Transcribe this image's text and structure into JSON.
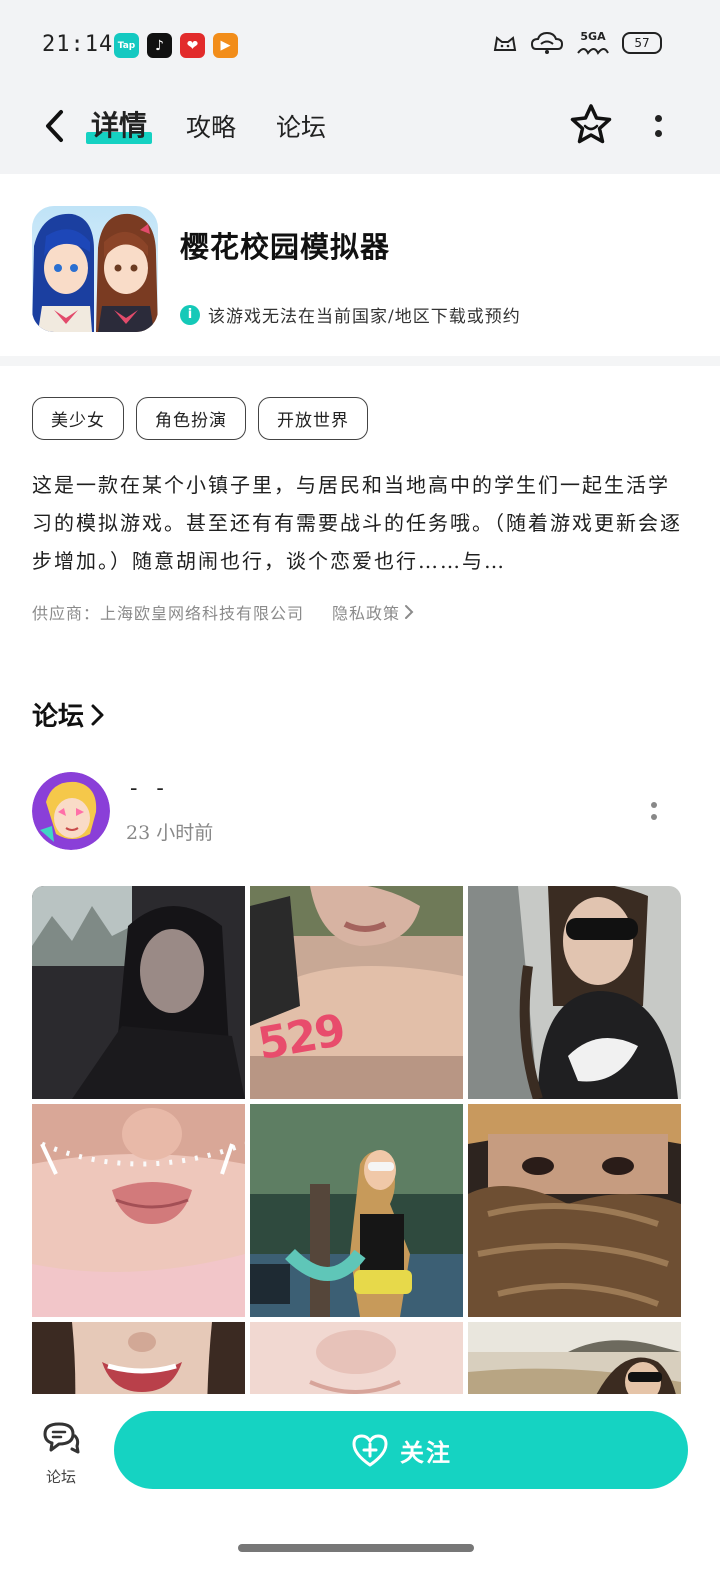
{
  "status_bar": {
    "time": "21:14",
    "apps": [
      {
        "name": "taptap-icon",
        "label": "Tap"
      },
      {
        "name": "tiktok-icon",
        "label": "♪"
      },
      {
        "name": "pinduoduo-icon",
        "label": "❤"
      },
      {
        "name": "bilibili-icon",
        "label": "▶"
      }
    ],
    "network_label": "5GA",
    "battery_level": "57"
  },
  "nav": {
    "tabs": [
      {
        "label": "详情",
        "active": true
      },
      {
        "label": "攻略",
        "active": false
      },
      {
        "label": "论坛",
        "active": false
      }
    ],
    "accent_color": "#15d1c2"
  },
  "game": {
    "title": "樱花校园模拟器",
    "region_notice": "该游戏无法在当前国家/地区下载或预约",
    "tags": [
      "美少女",
      "角色扮演",
      "开放世界"
    ],
    "description": "这是一款在某个小镇子里，与居民和当地高中的学生们一起生活学习的模拟游戏。甚至还有有需要战斗的任务哦。（随着游戏更新会逐步增加。）随意胡闹也行，谈个恋爱也行……与…",
    "supplier": "供应商：上海欧皇网络科技有限公司",
    "privacy_label": "隐私政策"
  },
  "forum": {
    "heading": "论坛",
    "post": {
      "author": "- -",
      "time": "23 小时前",
      "photo_caption_number": "529"
    }
  },
  "bottom": {
    "forum_label": "论坛",
    "follow_label": "关注"
  }
}
